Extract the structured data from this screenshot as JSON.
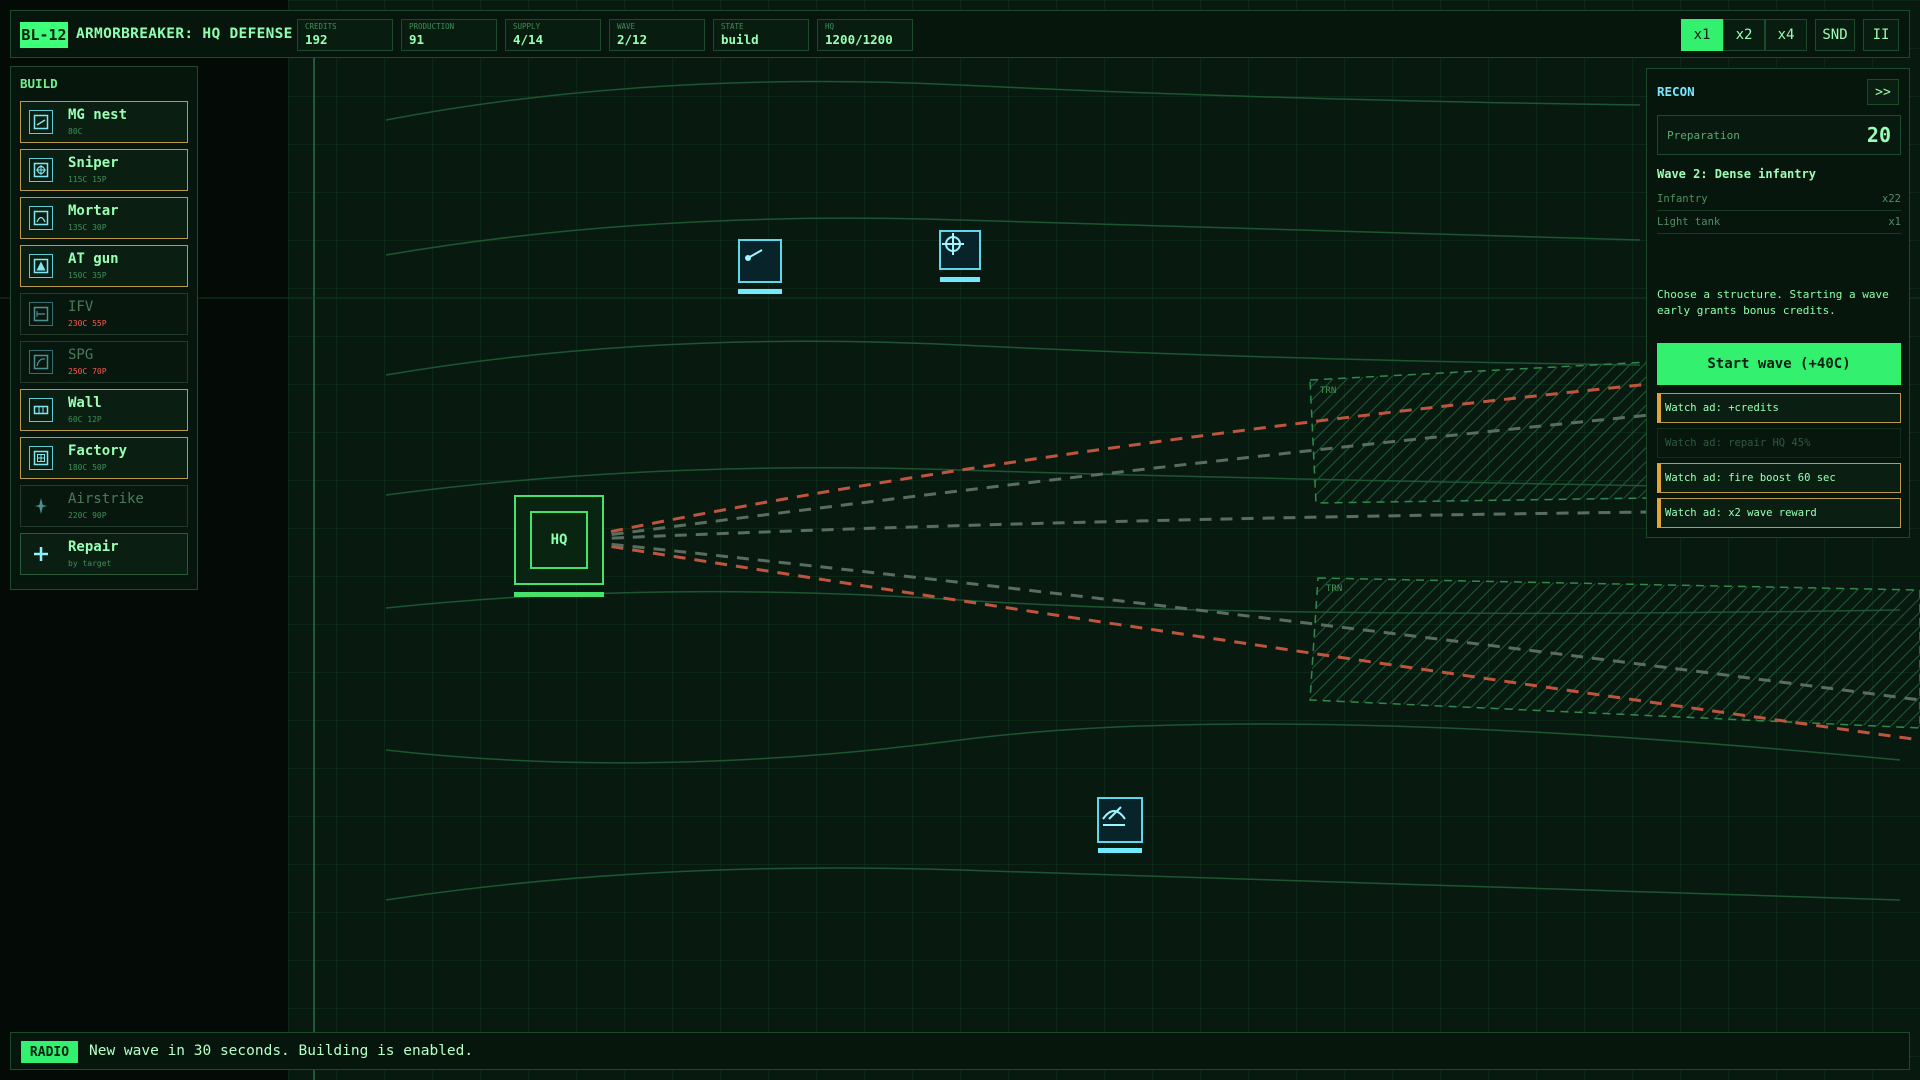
{
  "header": {
    "badge": "BL-12",
    "title": "ARMORBREAKER: HQ DEFENSE",
    "stats": [
      {
        "label": "CREDITS",
        "value": "192"
      },
      {
        "label": "PRODUCTION",
        "value": "91"
      },
      {
        "label": "SUPPLY",
        "value": "4/14"
      },
      {
        "label": "WAVE",
        "value": "2/12"
      },
      {
        "label": "STATE",
        "value": "build"
      },
      {
        "label": "HQ",
        "value": "1200/1200"
      }
    ],
    "speed": [
      "x1",
      "x2",
      "x4"
    ],
    "active_speed": "x1",
    "sound": "SND",
    "pause": "II"
  },
  "build": {
    "title": "BUILD",
    "items": [
      {
        "name": "MG nest",
        "cost": "80C",
        "enabled": true,
        "icon": "mg-nest-icon"
      },
      {
        "name": "Sniper",
        "cost": "115C 15P",
        "enabled": true,
        "icon": "sniper-icon"
      },
      {
        "name": "Mortar",
        "cost": "135C 30P",
        "enabled": true,
        "icon": "mortar-icon"
      },
      {
        "name": "AT gun",
        "cost": "150C 35P",
        "enabled": true,
        "icon": "at-gun-icon"
      },
      {
        "name": "IFV",
        "cost": "230C 55P",
        "enabled": false,
        "icon": "ifv-icon"
      },
      {
        "name": "SPG",
        "cost": "250C 70P",
        "enabled": false,
        "icon": "spg-icon"
      },
      {
        "name": "Wall",
        "cost": "60C 12P",
        "enabled": true,
        "icon": "wall-icon"
      },
      {
        "name": "Factory",
        "cost": "180C 50P",
        "enabled": true,
        "icon": "factory-icon"
      },
      {
        "name": "Airstrike",
        "cost": "220C 90P",
        "enabled": false,
        "icon": "airstrike-icon"
      },
      {
        "name": "Repair",
        "cost": "by target",
        "enabled": true,
        "icon": "repair-icon"
      }
    ]
  },
  "recon": {
    "title": "RECON",
    "collapse": ">>",
    "prep_label": "Preparation",
    "prep_value": "20",
    "wave_name": "Wave 2: Dense infantry",
    "enemies": [
      {
        "name": "Infantry",
        "count": "x22"
      },
      {
        "name": "Light tank",
        "count": "x1"
      }
    ],
    "hint": "Choose a structure. Starting a wave early grants bonus credits.",
    "start_button": "Start wave (+40C)",
    "ads": [
      {
        "label": "Watch ad: +credits",
        "enabled": true
      },
      {
        "label": "Watch ad: repair HQ 45%",
        "enabled": false
      },
      {
        "label": "Watch ad: fire boost 60 sec",
        "enabled": true
      },
      {
        "label": "Watch ad: x2 wave reward",
        "enabled": true
      }
    ]
  },
  "map": {
    "hq_label": "HQ",
    "terrain_label": "TRN"
  },
  "radio": {
    "tag": "RADIO",
    "message": "New wave in 30 seconds. Building is enabled."
  },
  "colors": {
    "accent": "#33f06f",
    "enemy_path": "#c0553f",
    "unit": "#5fd8ea",
    "warning": "#e0a53a"
  }
}
